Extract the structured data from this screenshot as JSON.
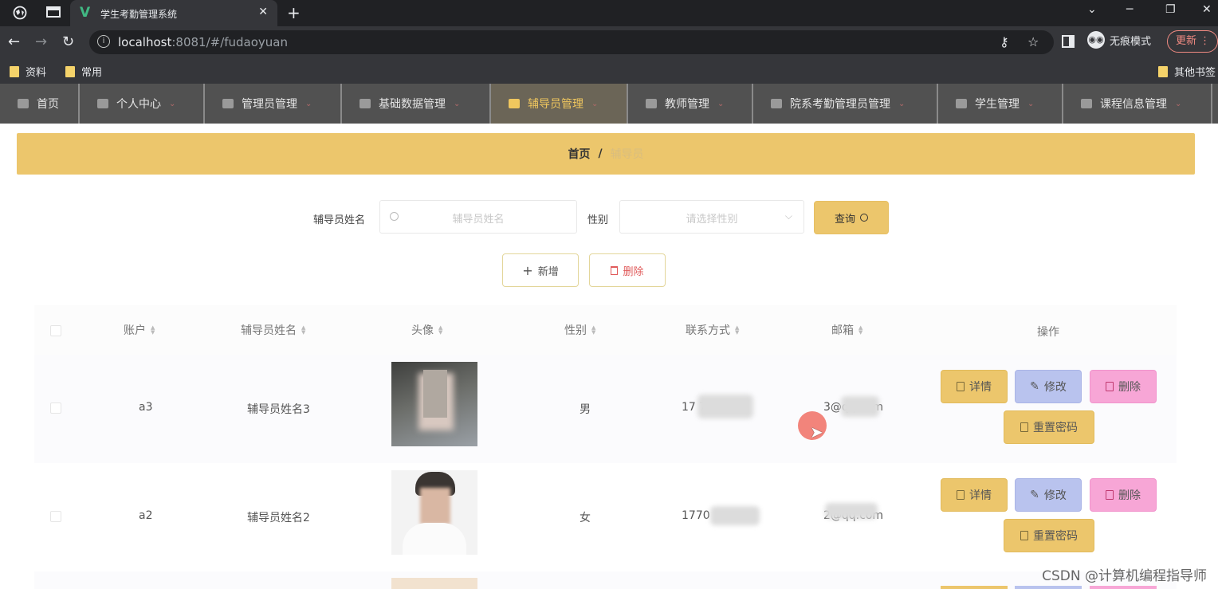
{
  "browser": {
    "tab_title": "学生考勤管理系统",
    "url_host": "localhost",
    "url_rest": ":8081/#/fudaoyuan",
    "incognito_label": "无痕模式",
    "update_label": "更新",
    "bookmarks": [
      "资料",
      "常用"
    ],
    "other_bookmarks": "其他书签"
  },
  "nav": {
    "items": [
      {
        "label": "首页",
        "width": 100
      },
      {
        "label": "个人中心",
        "width": 157
      },
      {
        "label": "管理员管理",
        "width": 172
      },
      {
        "label": "基础数据管理",
        "width": 187
      },
      {
        "label": "辅导员管理",
        "width": 172
      },
      {
        "label": "教师管理",
        "width": 157
      },
      {
        "label": "院系考勤管理员管理",
        "width": 232
      },
      {
        "label": "学生管理",
        "width": 157
      },
      {
        "label": "课程信息管理",
        "width": 187
      }
    ],
    "active_index": 4
  },
  "breadcrumb": {
    "home": "首页",
    "separator": "/",
    "current": "辅导员"
  },
  "search": {
    "name_label": "辅导员姓名",
    "name_placeholder": "辅导员姓名",
    "gender_label": "性别",
    "gender_placeholder": "请选择性别",
    "query_button": "查询"
  },
  "actions": {
    "add": "新增",
    "delete": "删除"
  },
  "table": {
    "columns": [
      "账户",
      "辅导员姓名",
      "头像",
      "性别",
      "联系方式",
      "邮箱",
      "操作"
    ],
    "rows": [
      {
        "account": "a3",
        "name": "辅导员姓名3",
        "gender": "男",
        "phone": "17 78 03",
        "email": "3@qq.com"
      },
      {
        "account": "a2",
        "name": "辅导员姓名2",
        "gender": "女",
        "phone": "1770",
        "email": "2@qq.com"
      }
    ],
    "row_actions": {
      "detail": "详情",
      "edit": "修改",
      "delete": "删除",
      "reset": "重置密码"
    }
  },
  "watermark": "CSDN @计算机编程指导师"
}
